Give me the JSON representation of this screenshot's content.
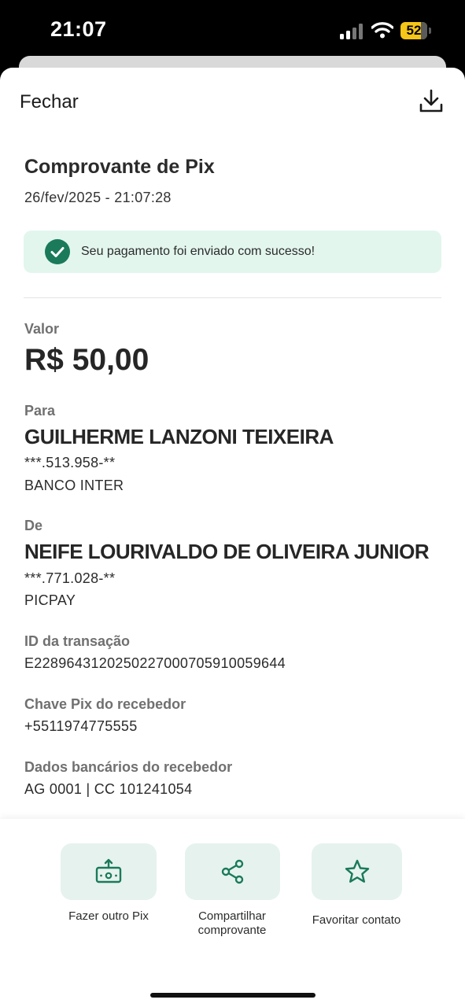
{
  "status_bar": {
    "time": "21:07",
    "battery": "52"
  },
  "header": {
    "close_label": "Fechar",
    "download_icon": "download-icon"
  },
  "receipt": {
    "title": "Comprovante de Pix",
    "date": "26/fev/2025 - 21:07:28",
    "success_message": "Seu pagamento foi enviado com sucesso!",
    "value_label": "Valor",
    "value": "R$ 50,00",
    "to_label": "Para",
    "to_name": "GUILHERME LANZONI TEIXEIRA",
    "to_doc": "***.513.958-**",
    "to_bank": "BANCO INTER",
    "from_label": "De",
    "from_name": "NEIFE LOURIVALDO DE OLIVEIRA JUNIOR",
    "from_doc": "***.771.028-**",
    "from_bank": "PICPAY",
    "transaction_label": "ID da transação",
    "transaction_id": "E22896431202502270007059100596​44",
    "pix_key_label": "Chave Pix do recebedor",
    "pix_key": "+5511974775555",
    "bank_data_label": "Dados bancários do recebedor",
    "bank_data": "AG 0001 | CC 101241054"
  },
  "actions": [
    {
      "label": "Fazer outro Pix",
      "icon": "pix-transfer-icon"
    },
    {
      "label": "Compartilhar comprovante",
      "icon": "share-icon"
    },
    {
      "label": "Favoritar contato",
      "icon": "star-icon"
    }
  ],
  "colors": {
    "accent": "#1a7a5a",
    "alert_bg": "#e2f6ee",
    "button_bg": "#e6f2ee",
    "battery": "#f5c518"
  }
}
